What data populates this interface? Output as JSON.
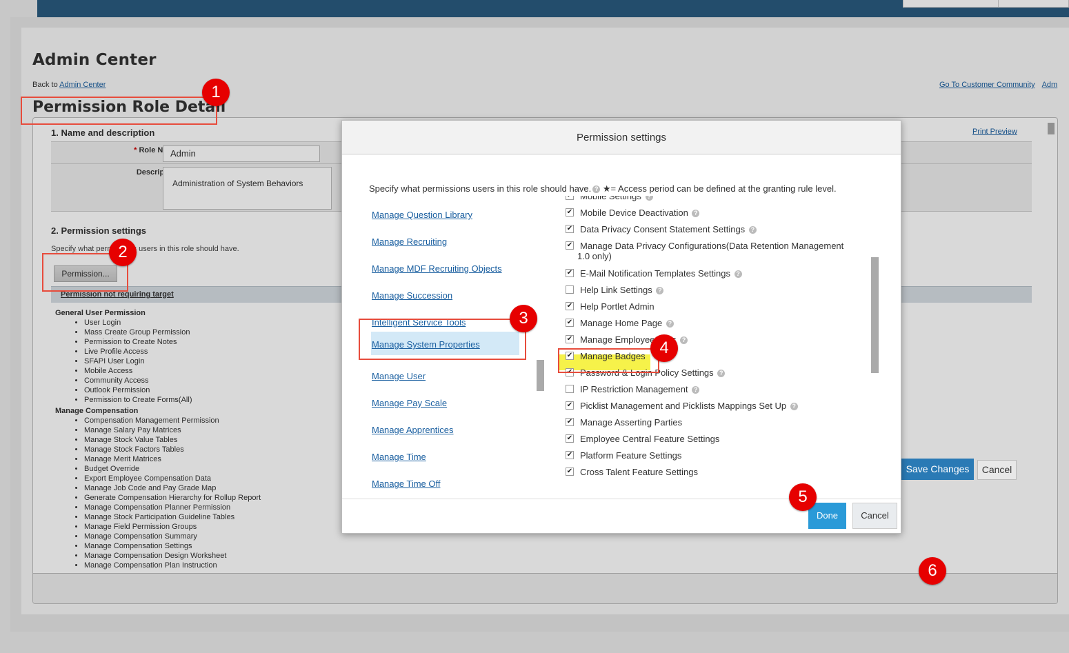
{
  "header": {
    "admin_center_title": "Admin Center",
    "back_prefix": "Back to ",
    "back_link": "Admin Center",
    "customer_community_link": "Go To Customer Community",
    "admin_link_truncated": "Adm",
    "page_title": "Permission Role Detail"
  },
  "detail": {
    "section1_title": "1. Name and description",
    "print_preview": "Print Preview",
    "role_name_label": "Role Name:",
    "role_name_value": "Admin",
    "description_label": "Description:",
    "description_value": "Administration of System Behaviors",
    "section2_title": "2. Permission settings",
    "section2_note": "Specify what permissions users in this role should have.",
    "permission_button": "Permission...",
    "bar_label": "Permission not requiring target",
    "perm_groups": [
      {
        "name": "General User Permission",
        "items": [
          "User Login",
          "Mass Create Group Permission",
          "Permission to Create Notes",
          "Live Profile Access",
          "SFAPI User Login",
          "Mobile Access",
          "Community Access",
          "Outlook Permission",
          "Permission to Create Forms(All)"
        ]
      },
      {
        "name": "Manage Compensation",
        "items": [
          "Compensation Management Permission",
          "Manage Salary Pay Matrices",
          "Manage Stock Value Tables",
          "Manage Stock Factors Tables",
          "Manage Merit Matrices",
          "Budget Override",
          "Export Employee Compensation Data",
          "Manage Job Code and Pay Grade Map",
          "Generate Compensation Hierarchy for Rollup Report",
          "Manage Compensation Planner Permission",
          "Manage Stock Participation Guideline Tables",
          "Manage Field Permission Groups",
          "Manage Compensation Summary",
          "Manage Compensation Settings",
          "Manage Compensation Design Worksheet",
          "Manage Compensation Plan Instruction"
        ]
      }
    ],
    "save_button": "Save Changes",
    "cancel_button": "Cancel"
  },
  "modal": {
    "title": "Permission settings",
    "intro": "Specify what permissions users in this role should have.",
    "intro_star": "★= Access period can be defined at the granting rule level.",
    "categories": [
      "Manage Question Library",
      "Manage Recruiting",
      "Manage MDF Recruiting Objects",
      "Manage Succession",
      "Intelligent Service Tools",
      "Manage System Properties",
      "Manage User",
      "Manage Pay Scale",
      "Manage Apprentices",
      "Manage Time",
      "Manage Time Off"
    ],
    "selected_category": "Manage System Properties",
    "options": [
      {
        "label": "Mobile Settings",
        "checked": true,
        "help": true
      },
      {
        "label": "Mobile Device Deactivation",
        "checked": true,
        "help": true
      },
      {
        "label": "Data Privacy Consent Statement Settings",
        "checked": true,
        "help": true
      },
      {
        "label": "Manage Data Privacy Configurations(Data Retention Management",
        "label2": "1.0 only)",
        "checked": true,
        "help": false
      },
      {
        "label": "E-Mail Notification Templates Settings",
        "checked": true,
        "help": true
      },
      {
        "label": "Help Link Settings",
        "checked": false,
        "help": true
      },
      {
        "label": "Help Portlet Admin",
        "checked": true,
        "help": false
      },
      {
        "label": "Manage Home Page",
        "checked": true,
        "help": true
      },
      {
        "label": "Manage Employee Files",
        "checked": true,
        "help": true
      },
      {
        "label": "Manage Badges",
        "checked": true,
        "help": false
      },
      {
        "label": "Password & Login Policy Settings",
        "checked": true,
        "help": true
      },
      {
        "label": "IP Restriction Management",
        "checked": false,
        "help": true
      },
      {
        "label": "Picklist Management and Picklists Mappings Set Up",
        "checked": true,
        "help": true
      },
      {
        "label": "Manage Asserting Parties",
        "checked": true,
        "help": false
      },
      {
        "label": "Employee Central Feature Settings",
        "checked": true,
        "help": false
      },
      {
        "label": "Platform Feature Settings",
        "checked": true,
        "help": false
      },
      {
        "label": "Cross Talent Feature Settings",
        "checked": true,
        "help": false
      }
    ],
    "done_button": "Done",
    "cancel_button": "Cancel"
  },
  "annotations": [
    "1",
    "2",
    "3",
    "4",
    "5",
    "6"
  ],
  "colors": {
    "annotation_red": "#e60000",
    "highlight_yellow": "#f6f24a",
    "primary_blue": "#2a9ad8",
    "link_blue": "#1a5fa0"
  }
}
